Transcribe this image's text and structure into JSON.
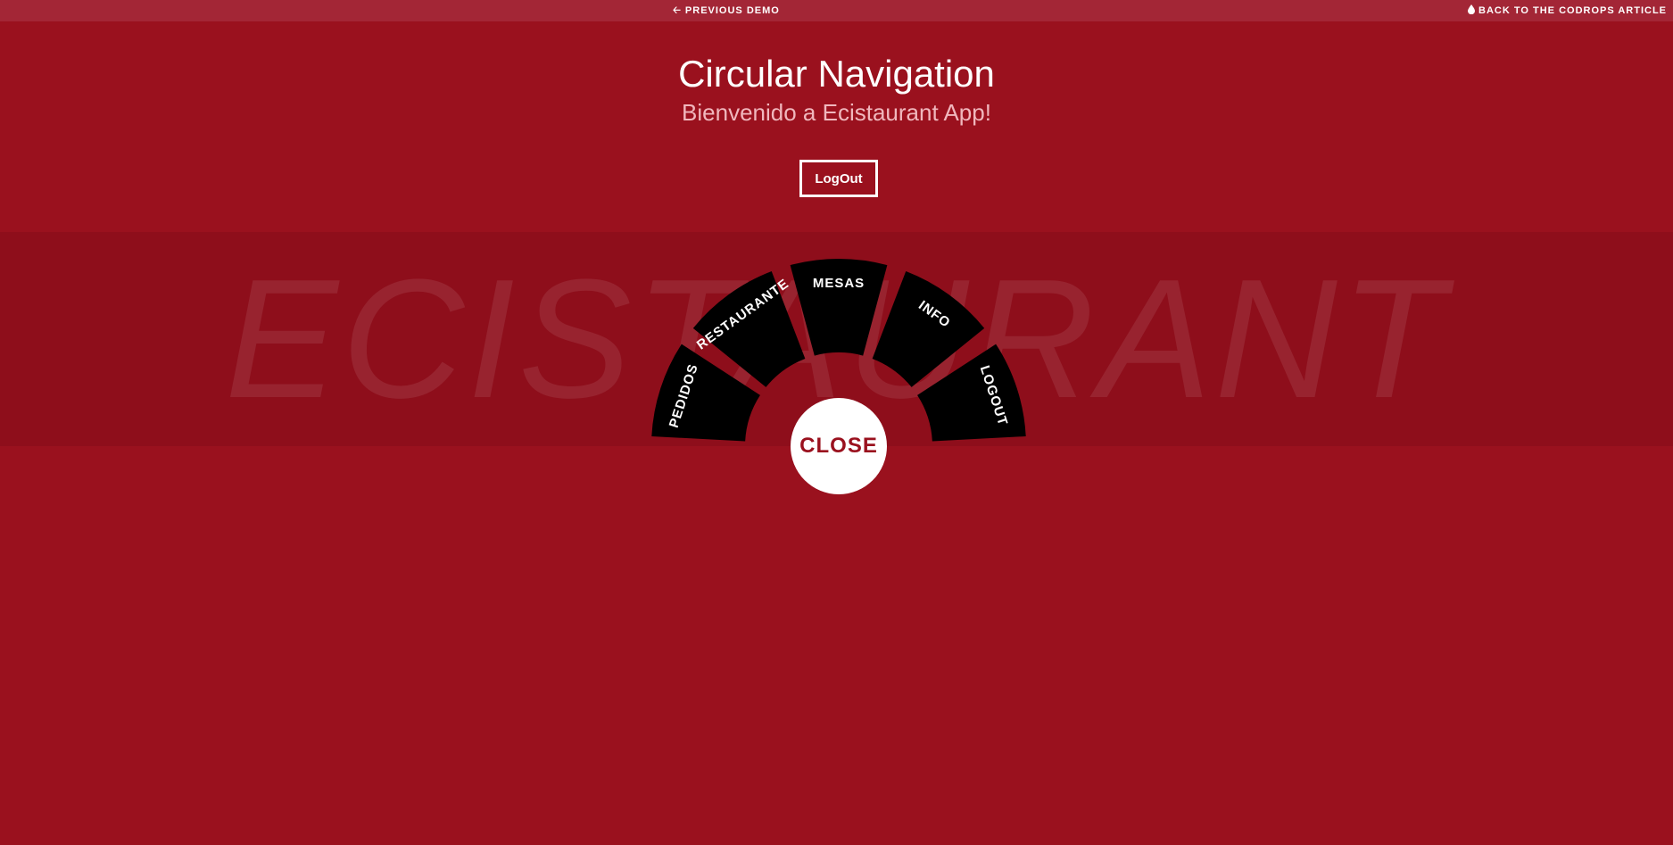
{
  "topbar": {
    "previous_demo": "Previous Demo",
    "previous_icon": "arrow-left-icon",
    "back_article": "Back to the Codrops Article",
    "back_icon": "drop-icon"
  },
  "header": {
    "title": "Circular Navigation",
    "subtitle": "Bienvenido a Ecistaurant App!",
    "logout_label": "LogOut"
  },
  "watermark": "ECISTAURANT",
  "nav": {
    "items": [
      {
        "label": "PEDIDOS"
      },
      {
        "label": "RESTAURANTE"
      },
      {
        "label": "MESAS"
      },
      {
        "label": "INFO"
      },
      {
        "label": "LOGOUT"
      }
    ],
    "close_label": "CLOSE"
  },
  "colors": {
    "background": "#9a111e",
    "band": "#8e0e1b",
    "topbar": "#a32636",
    "sector": "#000000",
    "close_text": "#9a111e"
  }
}
